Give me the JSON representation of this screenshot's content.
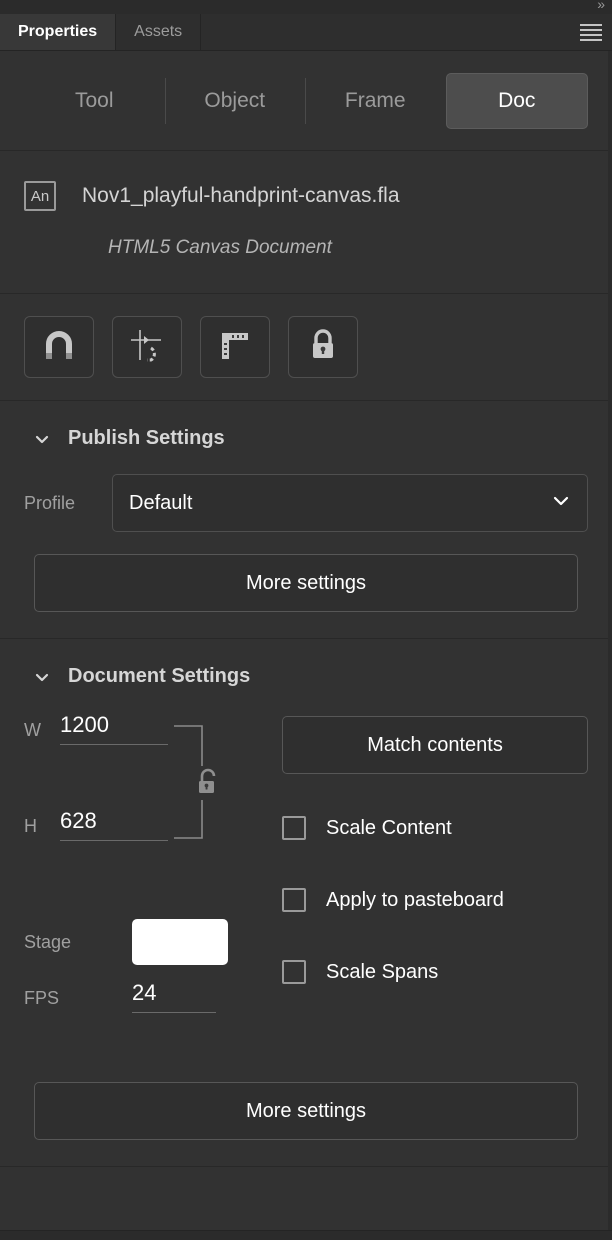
{
  "window": {
    "collapse_chevrons": "»"
  },
  "tabs": {
    "items": [
      {
        "label": "Properties",
        "active": true
      },
      {
        "label": "Assets",
        "active": false
      }
    ],
    "menu_icon": "hamburger-menu-icon"
  },
  "subtabs": {
    "items": [
      {
        "label": "Tool",
        "active": false
      },
      {
        "label": "Object",
        "active": false
      },
      {
        "label": "Frame",
        "active": false
      },
      {
        "label": "Doc",
        "active": true
      }
    ]
  },
  "document": {
    "icon_label": "An",
    "file_name": "Nov1_playful-handprint-canvas.fla",
    "doc_type": "HTML5 Canvas Document"
  },
  "icon_strip": {
    "items": [
      {
        "name": "snap-to-objects-icon"
      },
      {
        "name": "snap-align-icon"
      },
      {
        "name": "snap-to-guides-icon"
      },
      {
        "name": "lock-guides-icon"
      }
    ]
  },
  "publish_settings": {
    "title": "Publish Settings",
    "profile_label": "Profile",
    "profile_value": "Default",
    "profile_options": [
      "Default"
    ],
    "more_settings_label": "More settings"
  },
  "document_settings": {
    "title": "Document Settings",
    "width_label": "W",
    "width_value": "1200",
    "height_label": "H",
    "height_value": "628",
    "link_state": "unlocked",
    "stage_label": "Stage",
    "stage_color": "#ffffff",
    "fps_label": "FPS",
    "fps_value": "24",
    "match_contents_label": "Match contents",
    "checkboxes": [
      {
        "label": "Scale Content",
        "checked": false
      },
      {
        "label": "Apply to pasteboard",
        "checked": false
      },
      {
        "label": "Scale Spans",
        "checked": false
      }
    ],
    "more_settings_label": "More settings"
  },
  "theme": {
    "panel_bg": "#323232",
    "tab_bg": "#2e2e2e",
    "active_tab_bg": "#383838",
    "accent_text": "#ffffff",
    "muted_text": "#9b9b9b",
    "border": "#4f4f4f"
  }
}
